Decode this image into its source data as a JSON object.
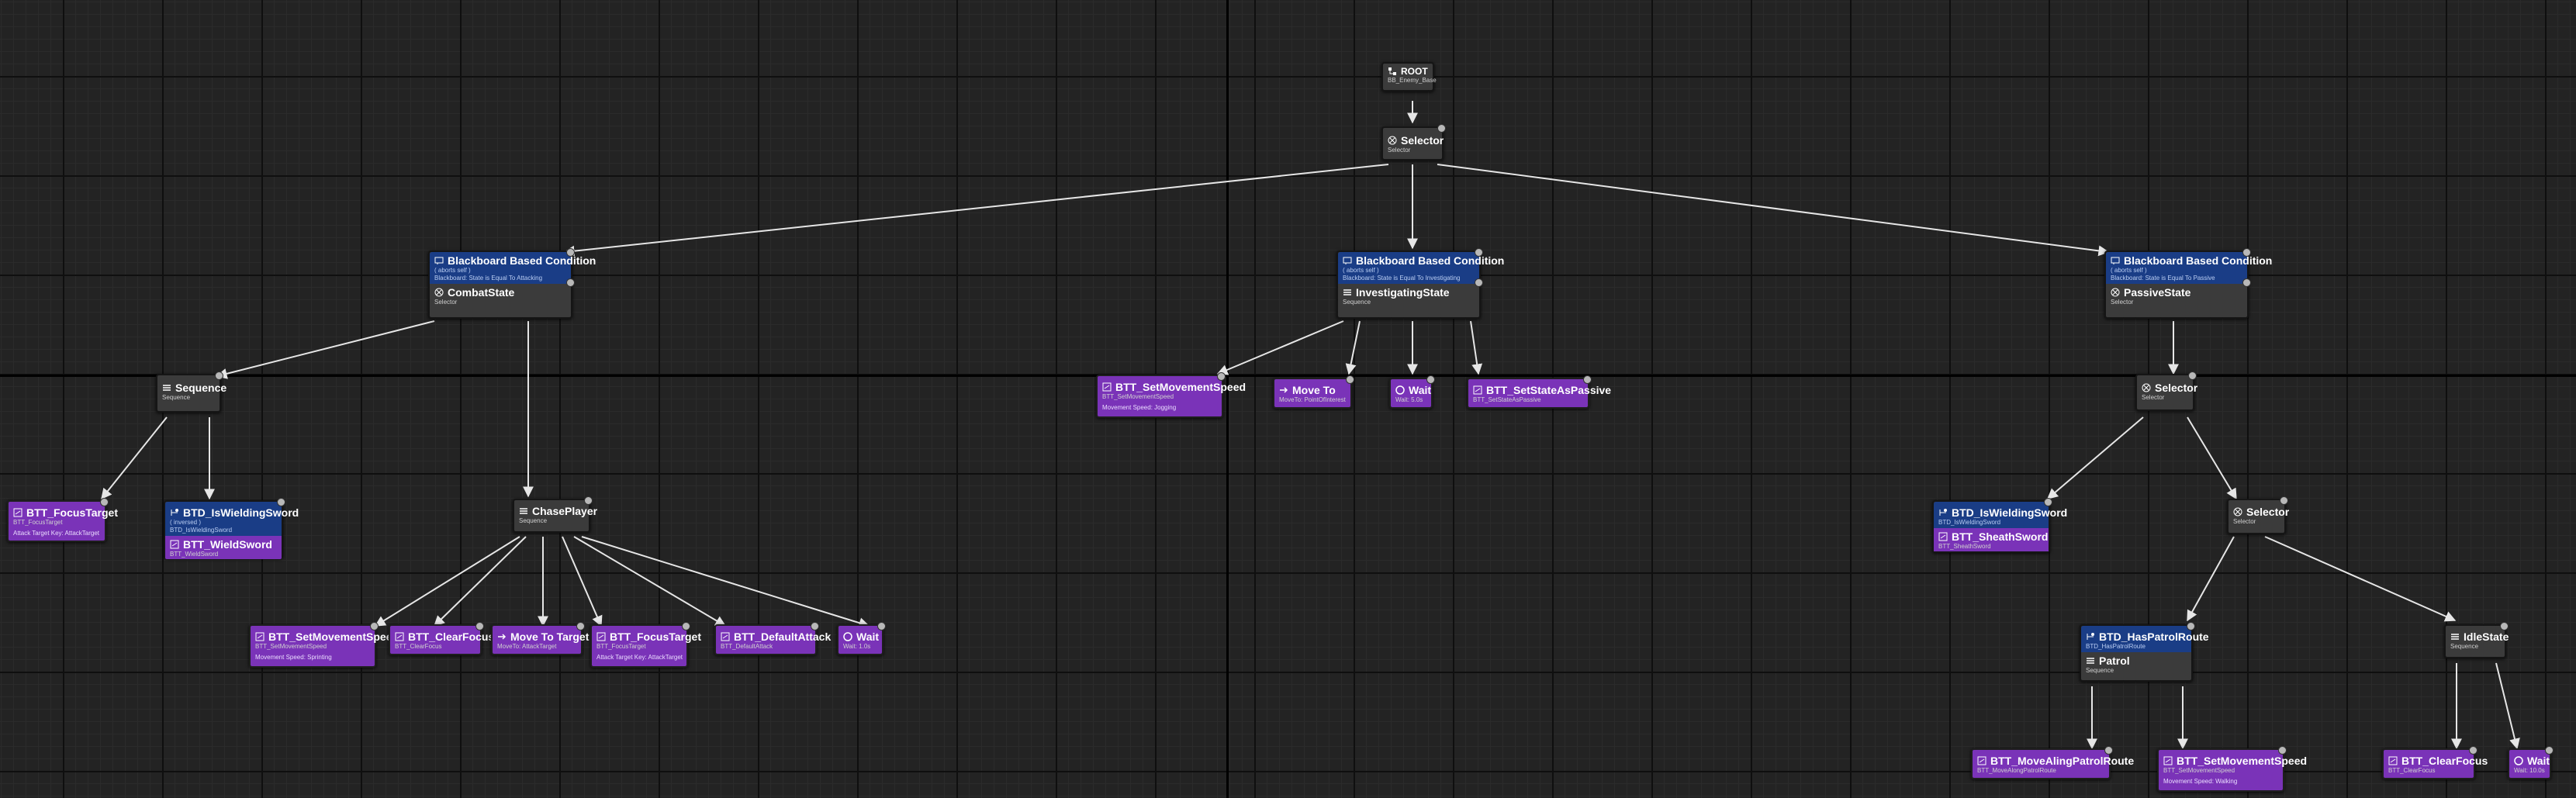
{
  "graph": {
    "root": {
      "title": "ROOT",
      "sub": "BB_Enemy_Base"
    },
    "top_selector": {
      "title": "Selector",
      "sub": "Selector"
    },
    "combat": {
      "dec_title": "Blackboard Based Condition",
      "dec_line1": "( aborts self )",
      "dec_line2": "Blackboard: State is Equal To Attacking",
      "title": "CombatState",
      "sub": "Selector"
    },
    "investigating": {
      "dec_title": "Blackboard Based Condition",
      "dec_line1": "( aborts self )",
      "dec_line2": "Blackboard: State is Equal To Investigating",
      "title": "InvestigatingState",
      "sub": "Sequence"
    },
    "passive": {
      "dec_title": "Blackboard Based Condition",
      "dec_line1": "( aborts self )",
      "dec_line2": "Blackboard: State is Equal To Passive",
      "title": "PassiveState",
      "sub": "Selector"
    },
    "combat_sequence": {
      "title": "Sequence",
      "sub": "Sequence"
    },
    "focus_target_1": {
      "title": "BTT_FocusTarget",
      "sub": "BTT_FocusTarget",
      "desc": "Attack Target Key: AttackTarget"
    },
    "wield_combo": {
      "dec_title": "BTD_IsWieldingSword",
      "dec_line1": "( inversed )",
      "dec_line2": "BTD_IsWieldingSword",
      "title": "BTT_WieldSword",
      "sub": "BTT_WieldSword"
    },
    "chase_player": {
      "title": "ChasePlayer",
      "sub": "Sequence"
    },
    "chase_tasks": [
      {
        "title": "BTT_SetMovementSpeed",
        "sub": "BTT_SetMovementSpeed",
        "desc": "Movement Speed: Sprinting"
      },
      {
        "title": "BTT_ClearFocus",
        "sub": "BTT_ClearFocus",
        "desc": ""
      },
      {
        "title": "Move To Target",
        "sub": "MoveTo: AttackTarget",
        "desc": ""
      },
      {
        "title": "BTT_FocusTarget",
        "sub": "BTT_FocusTarget",
        "desc": "Attack Target Key: AttackTarget"
      },
      {
        "title": "BTT_DefaultAttack",
        "sub": "BTT_DefaultAttack",
        "desc": ""
      },
      {
        "title": "Wait",
        "sub": "Wait: 1.0s",
        "desc": ""
      }
    ],
    "investigate_tasks": [
      {
        "title": "BTT_SetMovementSpeed",
        "sub": "BTT_SetMovementSpeed",
        "desc": "Movement Speed: Jogging"
      },
      {
        "title": "Move To",
        "sub": "MoveTo: PointOfInterest",
        "desc": ""
      },
      {
        "title": "Wait",
        "sub": "Wait: 5.0s",
        "desc": ""
      },
      {
        "title": "BTT_SetStateAsPassive",
        "sub": "BTT_SetStateAsPassive",
        "desc": ""
      }
    ],
    "passive_selector": {
      "title": "Selector",
      "sub": "Selector"
    },
    "sheath_combo": {
      "dec_title": "BTD_IsWieldingSword",
      "dec_line1": "BTD_IsWieldingSword",
      "title": "BTT_SheathSword",
      "sub": "BTT_SheathSword"
    },
    "inner_selector": {
      "title": "Selector",
      "sub": "Selector"
    },
    "patrol": {
      "dec_title": "BTD_HasPatrolRoute",
      "dec_line1": "BTD_HasPatrolRoute",
      "title": "Patrol",
      "sub": "Sequence"
    },
    "idle_state": {
      "title": "IdleState",
      "sub": "Sequence"
    },
    "patrol_tasks": [
      {
        "title": "BTT_MoveAlingPatrolRoute",
        "sub": "BTT_MoveAlongPatrolRoute",
        "desc": ""
      },
      {
        "title": "BTT_SetMovementSpeed",
        "sub": "BTT_SetMovementSpeed",
        "desc": "Movement Speed: Walking"
      }
    ],
    "idle_tasks": [
      {
        "title": "BTT_ClearFocus",
        "sub": "BTT_ClearFocus",
        "desc": ""
      },
      {
        "title": "Wait",
        "sub": "Wait: 10.0s",
        "desc": ""
      }
    ]
  },
  "colors": {
    "task": "#7a33b8",
    "decorator": "#1a3d86",
    "composite": "#3b3b3b",
    "wire": "#e6e6e6",
    "grid": "#232323"
  },
  "icons": {
    "composite": "selector-icon",
    "sequence": "sequence-icon",
    "task": "task-icon",
    "decorator": "decorator-icon",
    "moveto": "move-to-icon",
    "wait": "wait-icon"
  }
}
